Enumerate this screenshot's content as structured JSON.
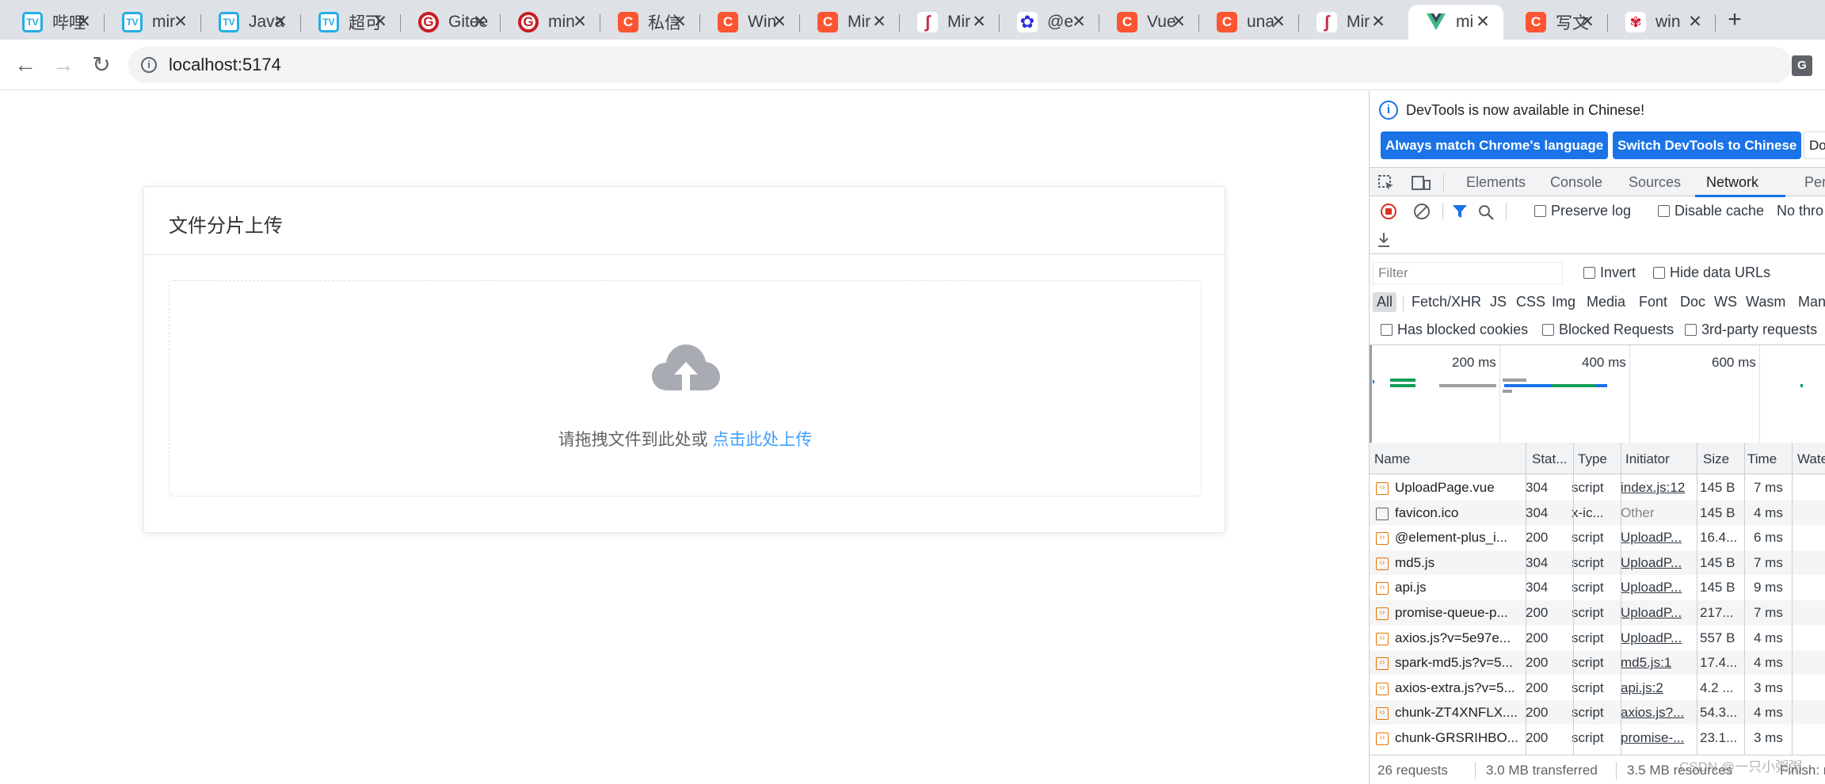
{
  "browser": {
    "tabs": [
      {
        "title": "哔哩",
        "favicon": "bilibili-icon"
      },
      {
        "title": "mir",
        "favicon": "bilibili-icon"
      },
      {
        "title": "Java",
        "favicon": "bilibili-icon"
      },
      {
        "title": "超可",
        "favicon": "bilibili-icon"
      },
      {
        "title": "Gitee",
        "favicon": "gitee-icon"
      },
      {
        "title": "min",
        "favicon": "gitee-icon"
      },
      {
        "title": "私信",
        "favicon": "csdn-icon"
      },
      {
        "title": "Win",
        "favicon": "csdn-icon"
      },
      {
        "title": "Mir",
        "favicon": "csdn-icon"
      },
      {
        "title": "Mir",
        "favicon": "minio-icon"
      },
      {
        "title": "@e",
        "favicon": "baidu-icon"
      },
      {
        "title": "Vue",
        "favicon": "csdn-icon"
      },
      {
        "title": "una",
        "favicon": "csdn-icon"
      },
      {
        "title": "Mir",
        "favicon": "minio-icon"
      },
      {
        "title": "mi",
        "favicon": "vue-icon"
      },
      {
        "title": "写文",
        "favicon": "csdn-icon"
      },
      {
        "title": "win",
        "favicon": "huawei-icon"
      }
    ],
    "url": "localhost:5174"
  },
  "page": {
    "card_title": "文件分片上传",
    "upload_text": "请拖拽文件到此处或",
    "upload_link": "点击此处上传"
  },
  "devtools": {
    "banner": "DevTools is now available in Chinese!",
    "btn_match": "Always match Chrome's language",
    "btn_switch": "Switch DevTools to Chinese",
    "btn_dont": "Do",
    "tabs": [
      "Elements",
      "Console",
      "Sources",
      "Network",
      "Perfor"
    ],
    "active_tab": "Network",
    "preserve_log": "Preserve log",
    "disable_cache": "Disable cache",
    "throttle": "No thro",
    "filter_placeholder": "Filter",
    "invert": "Invert",
    "hide_data_urls": "Hide data URLs",
    "type_filters": [
      "All",
      "Fetch/XHR",
      "JS",
      "CSS",
      "Img",
      "Media",
      "Font",
      "Doc",
      "WS",
      "Wasm",
      "Man"
    ],
    "has_blocked_cookies": "Has blocked cookies",
    "blocked_requests": "Blocked Requests",
    "third_party": "3rd-party requests",
    "timeline_labels": [
      "200 ms",
      "400 ms",
      "600 ms"
    ],
    "columns": [
      "Name",
      "Stat...",
      "Type",
      "Initiator",
      "Size",
      "Time",
      "Wate"
    ],
    "rows": [
      {
        "name": "UploadPage.vue",
        "status": "304",
        "type": "script",
        "initiator": "index.js:12",
        "size": "145 B",
        "time": "7 ms"
      },
      {
        "name": "favicon.ico",
        "status": "304",
        "type": "x-ic...",
        "initiator": "Other",
        "size": "145 B",
        "time": "4 ms"
      },
      {
        "name": "@element-plus_i...",
        "status": "200",
        "type": "script",
        "initiator": "UploadP...",
        "size": "16.4...",
        "time": "6 ms"
      },
      {
        "name": "md5.js",
        "status": "304",
        "type": "script",
        "initiator": "UploadP...",
        "size": "145 B",
        "time": "7 ms"
      },
      {
        "name": "api.js",
        "status": "304",
        "type": "script",
        "initiator": "UploadP...",
        "size": "145 B",
        "time": "9 ms"
      },
      {
        "name": "promise-queue-p...",
        "status": "200",
        "type": "script",
        "initiator": "UploadP...",
        "size": "217...",
        "time": "7 ms"
      },
      {
        "name": "axios.js?v=5e97e...",
        "status": "200",
        "type": "script",
        "initiator": "UploadP...",
        "size": "557 B",
        "time": "4 ms"
      },
      {
        "name": "spark-md5.js?v=5...",
        "status": "200",
        "type": "script",
        "initiator": "md5.js:1",
        "size": "17.4...",
        "time": "4 ms"
      },
      {
        "name": "axios-extra.js?v=5...",
        "status": "200",
        "type": "script",
        "initiator": "api.js:2",
        "size": "4.2 ...",
        "time": "3 ms"
      },
      {
        "name": "chunk-ZT4XNFLX....",
        "status": "200",
        "type": "script",
        "initiator": "axios.js?...",
        "size": "54.3...",
        "time": "4 ms"
      },
      {
        "name": "chunk-GRSRIHBO...",
        "status": "200",
        "type": "script",
        "initiator": "promise-...",
        "size": "23.1...",
        "time": "3 ms"
      }
    ],
    "status_requests": "26 requests",
    "status_transferred": "3.0 MB transferred",
    "status_resources": "3.5 MB resources",
    "status_finish": "Finish: m"
  },
  "watermark": "CSDN @一只小粥粥",
  "colors": {
    "accent": "#1a73e8",
    "link": "#409eff",
    "record": "#d93025"
  }
}
